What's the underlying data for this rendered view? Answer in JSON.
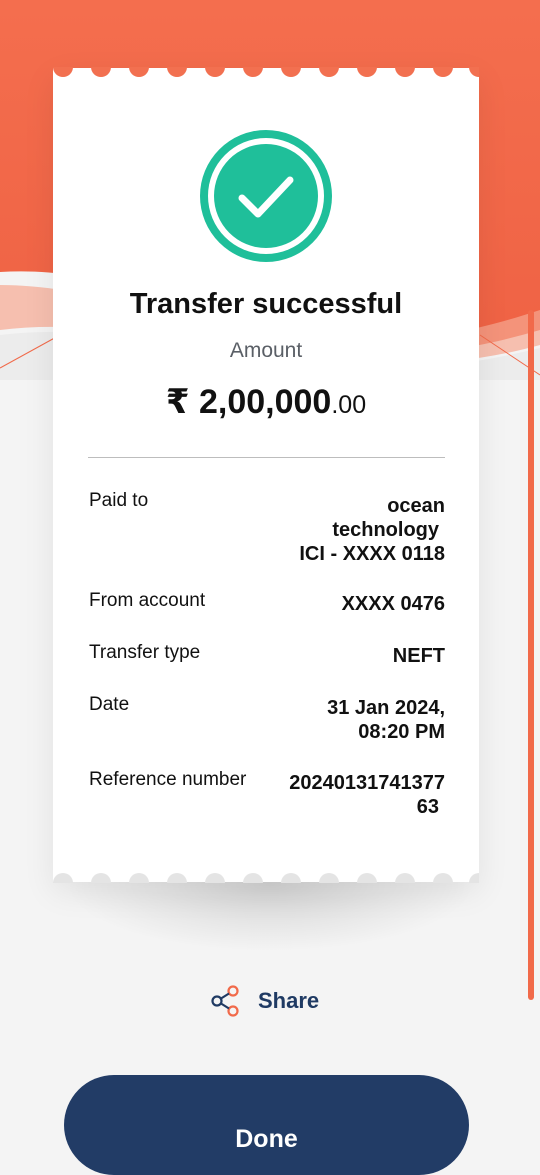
{
  "colors": {
    "brand_orange": "#f16a4a",
    "success_green": "#1fbf9a",
    "navy": "#223c66"
  },
  "receipt": {
    "title": "Transfer successful",
    "amount_label": "Amount",
    "amount_main": "₹ 2,00,000",
    "amount_decimal": ".00",
    "details": {
      "paid_to_label": "Paid to",
      "paid_to_name_line1": "ocean",
      "paid_to_name_line2": "technology",
      "paid_to_account": "ICI - XXXX 0118",
      "from_account_label": "From account",
      "from_account_value": "XXXX 0476",
      "transfer_type_label": "Transfer type",
      "transfer_type_value": "NEFT",
      "date_label": "Date",
      "date_value_line1": "31 Jan 2024,",
      "date_value_line2": "08:20 PM",
      "reference_label": "Reference number",
      "reference_value_line1": "20240131741377",
      "reference_value_line2": "63"
    }
  },
  "actions": {
    "share_label": "Share",
    "share_icon": "share-icon",
    "done_label": "Done"
  }
}
